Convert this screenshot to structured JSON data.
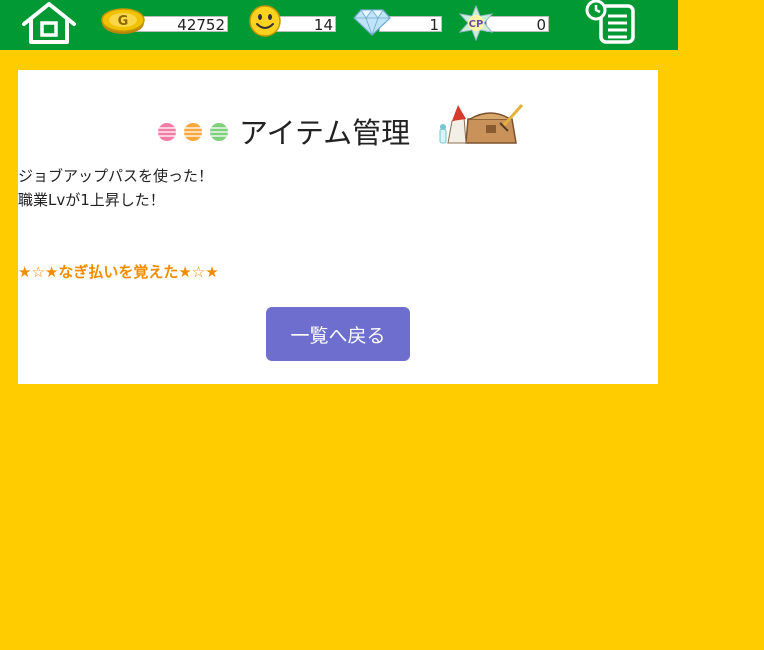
{
  "header": {
    "gold": "42752",
    "smile": "14",
    "diamond": "1",
    "cp": "0",
    "cp_icon_text": "CP",
    "gold_icon_text": "G"
  },
  "colors": {
    "background": "#FFCC00",
    "header_bar": "#009933",
    "panel": "#FFFFFF",
    "button": "#6E6ECF",
    "skill_text": "#F08C00"
  },
  "icons": {
    "home": "home-icon",
    "gold": "gold-coin-icon",
    "smile": "smile-face-icon",
    "diamond": "diamond-icon",
    "cp": "cp-star-icon",
    "menu": "clock-list-icon"
  },
  "panel": {
    "title": "アイテム管理",
    "message_line1": "ジョブアップパスを使った！",
    "message_line2": "職業Lvが1上昇した！",
    "skill_message": "★☆★なぎ払いを覚えた★☆★",
    "back_button": "一覧へ戻る"
  }
}
